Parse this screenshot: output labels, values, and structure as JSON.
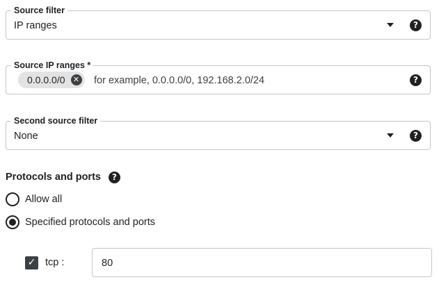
{
  "source_filter": {
    "label": "Source filter",
    "value": "IP ranges"
  },
  "source_ip_ranges": {
    "label": "Source IP ranges *",
    "chip": "0.0.0.0/0",
    "placeholder": "for example, 0.0.0.0/0, 192.168.2.0/24"
  },
  "second_source_filter": {
    "label": "Second source filter",
    "value": "None"
  },
  "protocols": {
    "title": "Protocols and ports",
    "options": [
      {
        "label": "Allow all",
        "selected": false
      },
      {
        "label": "Specified protocols and ports",
        "selected": true
      }
    ],
    "tcp": {
      "label": "tcp :",
      "checked": true,
      "ports": "80"
    }
  },
  "icons": {
    "help": "?",
    "close": "✕",
    "check": "✓"
  }
}
